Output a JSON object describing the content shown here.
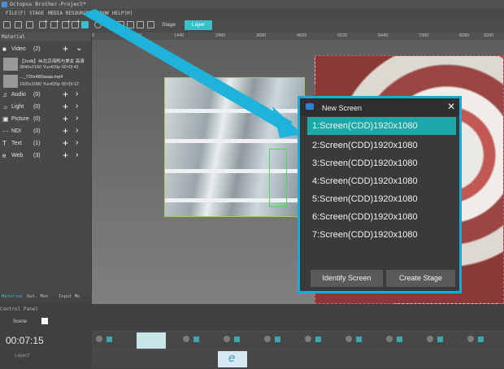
{
  "app": {
    "title": "Octopus Brother-Project*"
  },
  "menu": [
    "FILE(F)",
    "STAGE",
    "MEDIA RESOURCES",
    "WINDOW",
    "HELP(H)"
  ],
  "toolbar": {
    "tab_stage": "Stage",
    "tab_layer": "Layer"
  },
  "material": {
    "header": "Material",
    "categories": [
      {
        "icon": "video-icon",
        "label": "Video",
        "count": "(2)"
      },
      {
        "icon": "audio-icon",
        "label": "Audio",
        "count": "(0)"
      },
      {
        "icon": "light-icon",
        "label": "Light",
        "count": "(0)"
      },
      {
        "icon": "picture-icon",
        "label": "Picture",
        "count": "(0)"
      },
      {
        "icon": "ndi-icon",
        "label": "NDI",
        "count": "(0)"
      },
      {
        "icon": "text-icon",
        "label": "Text",
        "count": "(1)"
      },
      {
        "icon": "web-icon",
        "label": "Web",
        "count": "(3)"
      }
    ],
    "media": [
      {
        "name": "【2ndk】4k北京海鸭与美女 高清",
        "meta": "3840x2160 Yuv420p   00:03:41"
      },
      {
        "name": "..._720x480aaaa.mp4",
        "meta": "1920x1080 Yuv420p   00:09:12"
      }
    ],
    "bottom_tabs": [
      "Material",
      "Out. Mon",
      "Input Mo"
    ]
  },
  "ruler": [
    "0",
    "920",
    "1440",
    "2460",
    "3680",
    "4600",
    "5520",
    "6440",
    "7360",
    "8280",
    "9200"
  ],
  "control": {
    "header": "Control Panel",
    "scene_label": "Scene",
    "time": "00:07:15",
    "layer_label": "Layer2"
  },
  "dialog": {
    "title": "New Screen",
    "items": [
      "1:Screen(CDD)1920x1080",
      "2:Screen(CDD)1920x1080",
      "3:Screen(CDD)1920x1080",
      "4:Screen(CDD)1920x1080",
      "5:Screen(CDD)1920x1080",
      "6:Screen(CDD)1920x1080",
      "7:Screen(CDD)1920x1080"
    ],
    "identify_label": "Identify Screen",
    "create_label": "Create Stage"
  },
  "colors": {
    "accent": "#1fb7c4",
    "dialog_border": "#1fa9d6",
    "selected_item": "#1aa8a8"
  }
}
